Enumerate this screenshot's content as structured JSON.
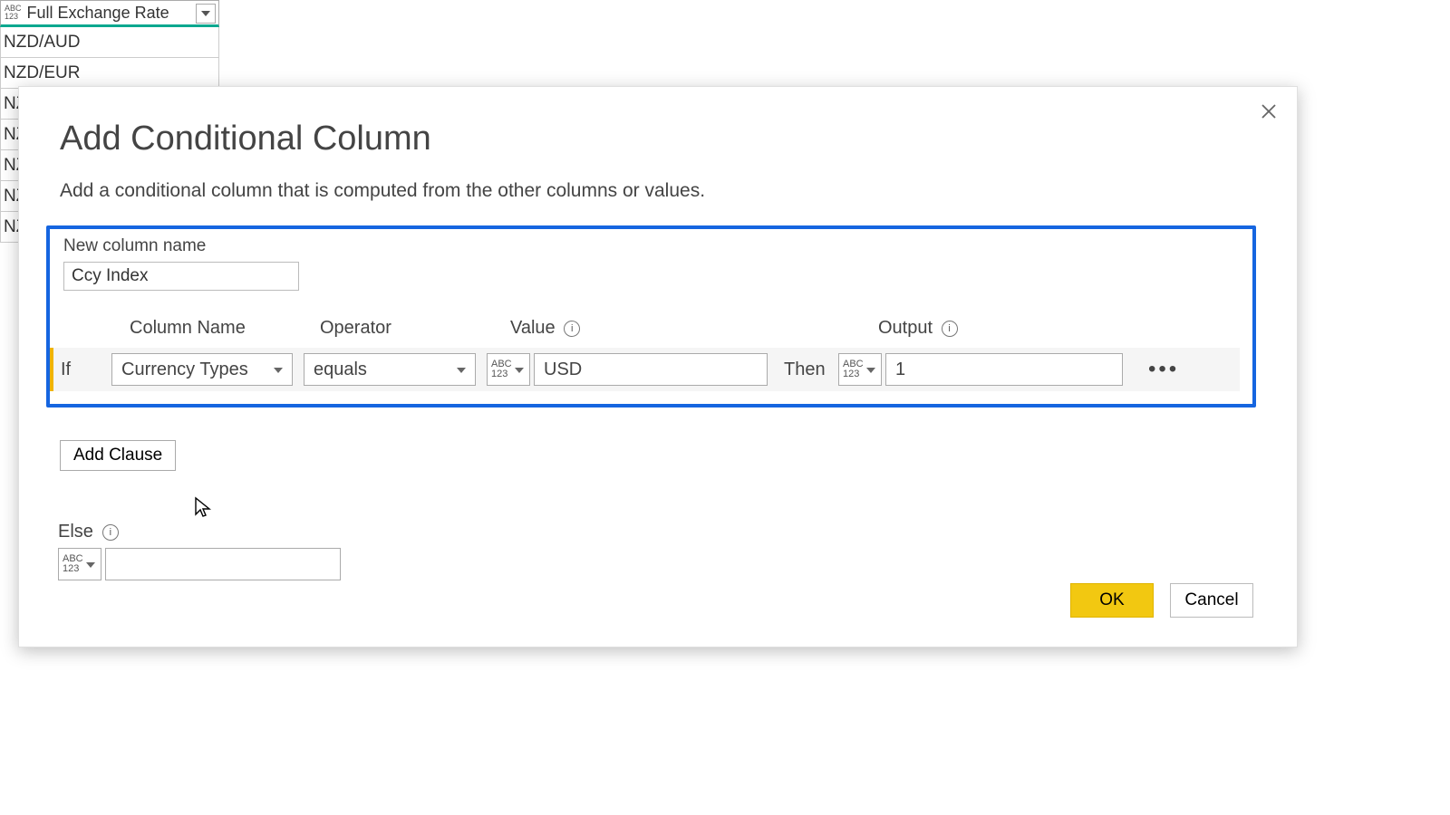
{
  "bg_column": {
    "header": "Full Exchange Rate",
    "icon_text": "ABC\n123",
    "rows": [
      "NZD/AUD",
      "NZD/EUR",
      "NZ",
      "NZ",
      "NZ",
      "NZ",
      "NZ"
    ]
  },
  "dialog": {
    "title": "Add Conditional Column",
    "subtitle": "Add a conditional column that is computed from the other columns or values.",
    "new_col_label": "New column name",
    "new_col_value": "Ccy Index",
    "headers": {
      "column": "Column Name",
      "operator": "Operator",
      "value": "Value",
      "output": "Output"
    },
    "clause": {
      "if_label": "If",
      "column": "Currency Types",
      "operator": "equals",
      "type_badge": "ABC\n123",
      "value": "USD",
      "then_label": "Then",
      "output_type_badge": "ABC\n123",
      "output": "1"
    },
    "add_clause": "Add Clause",
    "else_label": "Else",
    "else_type_badge": "ABC\n123",
    "else_value": "",
    "ok": "OK",
    "cancel": "Cancel"
  }
}
